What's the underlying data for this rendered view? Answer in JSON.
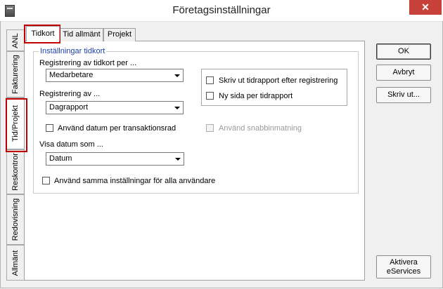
{
  "window": {
    "title": "Företagsinställningar",
    "close": "✕"
  },
  "side_tabs": [
    "ANL",
    "Fakturering",
    "Tid/Projekt",
    "Reskontror",
    "Redovisning",
    "Allmänt"
  ],
  "top_tabs": [
    "Tidkort",
    "Tid allmänt",
    "Projekt"
  ],
  "group": {
    "legend": "Inställningar tidkort",
    "reg_per_label": "Registrering av tidkort per ...",
    "reg_per_value": "Medarbetare",
    "reg_av_label": "Registrering av ...",
    "reg_av_value": "Dagrapport",
    "use_date_cb": "Använd datum per transaktionsrad",
    "quick_input_cb": "Använd snabbinmatning",
    "show_date_label": "Visa datum som ...",
    "show_date_value": "Datum",
    "same_settings_cb": "Använd samma inställningar för alla användare",
    "print_report_cb": "Skriv ut tidrapport efter registrering",
    "new_page_cb": "Ny sida per tidrapport"
  },
  "buttons": {
    "ok": "OK",
    "cancel": "Avbryt",
    "print": "Skriv ut...",
    "eservices_1": "Aktivera",
    "eservices_2": "eServices"
  }
}
